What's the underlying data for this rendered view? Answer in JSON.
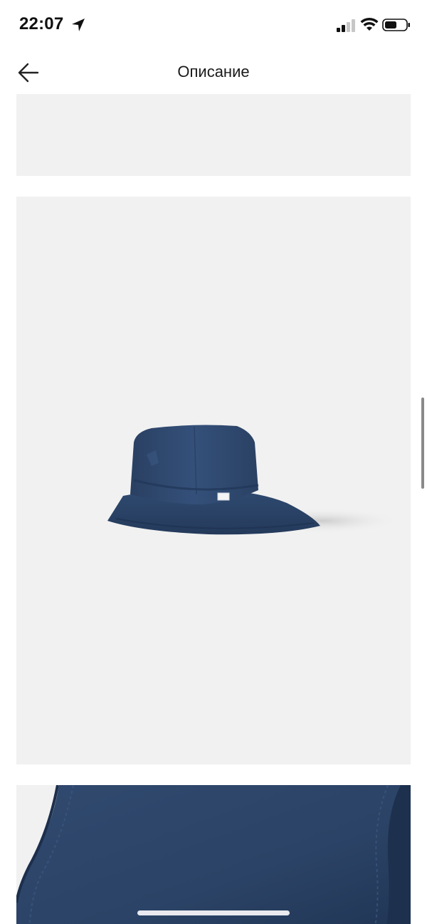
{
  "status_bar": {
    "time": "22:07",
    "icons": [
      "location-arrow-icon",
      "cellular-signal-icon",
      "wifi-icon",
      "battery-icon"
    ]
  },
  "header": {
    "title": "Описание",
    "back_icon": "arrow-left-icon"
  },
  "gallery": {
    "images": [
      {
        "name": "product-image-top",
        "kind": "blank-light-gray"
      },
      {
        "name": "product-image-hat",
        "kind": "navy-bucket-hat-photo"
      },
      {
        "name": "product-image-fabric-closeup",
        "kind": "navy-fabric-closeup"
      }
    ]
  },
  "colors": {
    "image_background": "#f1f1f1",
    "hat_navy": "#2c4467",
    "scroll_indicator": "#8a8a8a"
  }
}
